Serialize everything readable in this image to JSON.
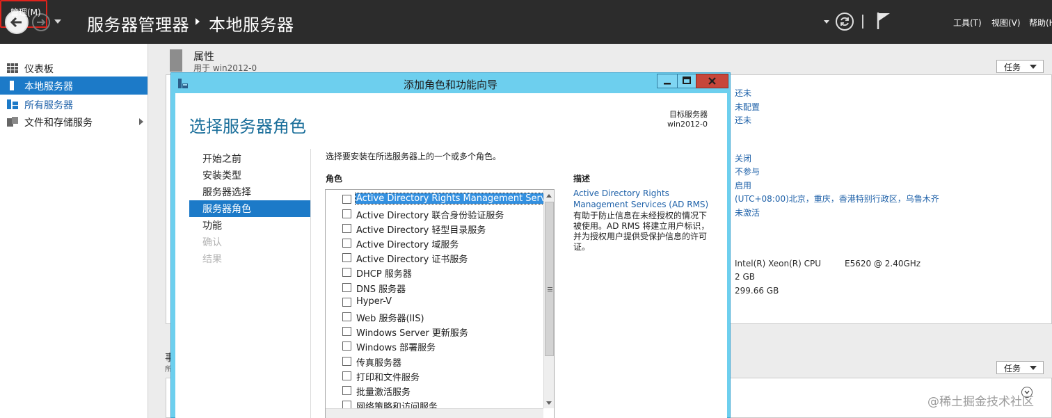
{
  "toolbar": {
    "breadcrumb_app": "服务器管理器",
    "breadcrumb_page": "本地服务器",
    "menu_manage": "管理(M)",
    "menu_tools": "工具(T)",
    "menu_view": "视图(V)",
    "menu_help": "帮助(H)",
    "highlight_color": "#e0231c"
  },
  "sidebar": {
    "items": [
      {
        "label": "仪表板",
        "icon": "dashboard-icon"
      },
      {
        "label": "本地服务器",
        "icon": "local-server-icon",
        "selected": true
      },
      {
        "label": "所有服务器",
        "icon": "all-servers-icon"
      },
      {
        "label": "文件和存储服务",
        "icon": "file-storage-icon"
      }
    ]
  },
  "properties": {
    "title": "属性",
    "subtitle": "用于 win2012-0",
    "tasks_label": "任务",
    "values": [
      "还未",
      "未配置",
      "还未",
      "关闭",
      "不参与",
      "启用",
      "(UTC+08:00)北京，重庆，香港特别行政区，乌鲁木齐",
      "未激活"
    ],
    "hardware": [
      "Intel(R) Xeon(R) CPU",
      "E5620  @ 2.40GHz",
      "2 GB",
      "299.66 GB"
    ]
  },
  "events": {
    "title": "事",
    "subtitle": "所",
    "tasks_label": "任务"
  },
  "watermark": "@稀土掘金技术社区",
  "wizard": {
    "title": "添加角色和功能向导",
    "heading": "选择服务器角色",
    "target_label": "目标服务器",
    "target_value": "win2012-0",
    "steps": [
      {
        "label": "开始之前",
        "state": "normal"
      },
      {
        "label": "安装类型",
        "state": "normal"
      },
      {
        "label": "服务器选择",
        "state": "normal"
      },
      {
        "label": "服务器角色",
        "state": "selected"
      },
      {
        "label": "功能",
        "state": "normal"
      },
      {
        "label": "确认",
        "state": "disabled"
      },
      {
        "label": "结果",
        "state": "disabled"
      }
    ],
    "instruction": "选择要安装在所选服务器上的一个或多个角色。",
    "roles_header": "角色",
    "desc_header": "描述",
    "roles": [
      "Active Directory Rights Management Services",
      "Active Directory 联合身份验证服务",
      "Active Directory 轻型目录服务",
      "Active Directory 域服务",
      "Active Directory 证书服务",
      "DHCP 服务器",
      "DNS 服务器",
      "Hyper-V",
      "Web 服务器(IIS)",
      "Windows Server 更新服务",
      "Windows 部署服务",
      "传真服务器",
      "打印和文件服务",
      "批量激活服务",
      "网络策略和访问服务"
    ],
    "desc_link": "Active Directory Rights Management Services (AD RMS)",
    "desc_text": "有助于防止信息在未经授权的情况下被使用。AD RMS 将建立用户标识，并为授权用户提供受保护信息的许可证。"
  }
}
